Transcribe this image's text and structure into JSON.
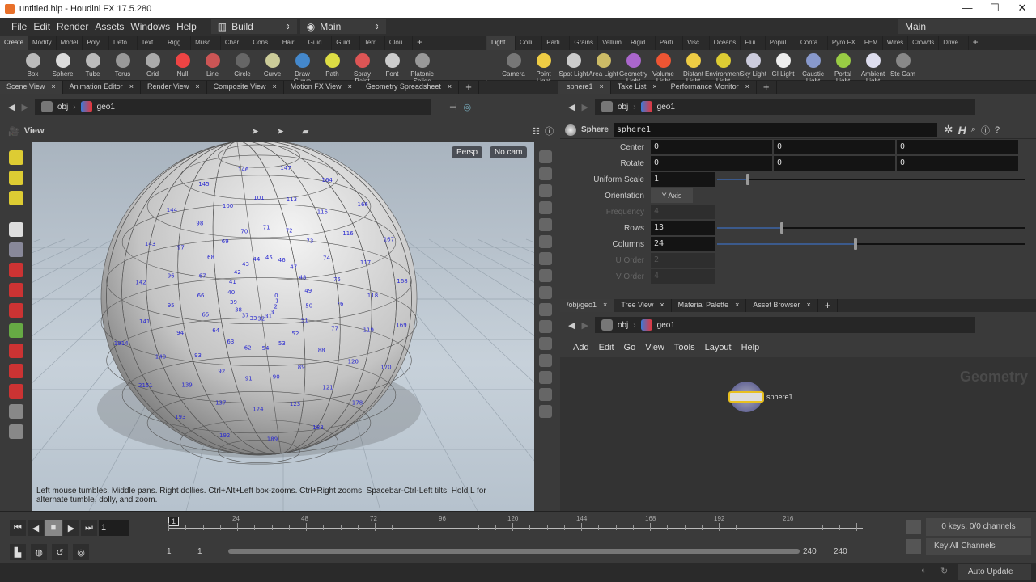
{
  "window": {
    "title": "untitled.hip - Houdini FX 17.5.280",
    "controls": [
      "—",
      "☐",
      "✕"
    ]
  },
  "menu": {
    "items": [
      "File",
      "Edit",
      "Render",
      "Assets",
      "Windows",
      "Help"
    ],
    "desktop": "Build",
    "context": "Main",
    "right_context": "Main"
  },
  "shelf_left": {
    "tabs": [
      "Create",
      "Modify",
      "Model",
      "Poly...",
      "Defo...",
      "Text...",
      "Rigg...",
      "Musc...",
      "Char...",
      "Cons...",
      "Hair...",
      "Guid...",
      "Guid...",
      "Terr...",
      "Clou..."
    ],
    "tools": [
      "Box",
      "Sphere",
      "Tube",
      "Torus",
      "Grid",
      "Null",
      "Line",
      "Circle",
      "Curve",
      "Draw Curve",
      "Path",
      "Spray Paint",
      "Font",
      "Platonic Solids"
    ]
  },
  "shelf_right": {
    "tabs": [
      "Light...",
      "Colli...",
      "Parti...",
      "Grains",
      "Vellum",
      "Rigid...",
      "Parti...",
      "Visc...",
      "Oceans",
      "Flui...",
      "Popul...",
      "Conta...",
      "Pyro FX",
      "FEM",
      "Wires",
      "Crowds",
      "Drive..."
    ],
    "tools": [
      "Camera",
      "Point Light",
      "Spot Light",
      "Area Light",
      "Geometry Light",
      "Volume Light",
      "Distant Light",
      "Environment Light",
      "Sky Light",
      "GI Light",
      "Caustic Light",
      "Portal Light",
      "Ambient Light",
      "Ste Cam"
    ]
  },
  "left_pane": {
    "tabs": [
      "Scene View",
      "Animation Editor",
      "Render View",
      "Composite View",
      "Motion FX View",
      "Geometry Spreadsheet"
    ],
    "path": [
      "obj",
      "geo1"
    ],
    "view_label": "View",
    "persp": "Persp",
    "cam": "No cam",
    "hint": "Left mouse tumbles. Middle pans. Right dollies. Ctrl+Alt+Left box-zooms. Ctrl+Right zooms. Spacebar-Ctrl-Left tilts. Hold L for alternate tumble, dolly, and zoom.",
    "point_numbers": [
      "0",
      "1",
      "2",
      "3",
      "31",
      "32",
      "33",
      "37",
      "38",
      "39",
      "40",
      "41",
      "42",
      "43",
      "44",
      "45",
      "46",
      "47",
      "48",
      "49",
      "50",
      "51",
      "52",
      "53",
      "54",
      "62",
      "63",
      "64",
      "65",
      "66",
      "67",
      "68",
      "69",
      "70",
      "71",
      "72",
      "73",
      "74",
      "75",
      "76",
      "77",
      "88",
      "89",
      "90",
      "91",
      "92",
      "93",
      "94",
      "95",
      "96",
      "97",
      "98",
      "100",
      "101",
      "113",
      "115",
      "116",
      "117",
      "118",
      "119",
      "120",
      "121",
      "123",
      "124",
      "137",
      "139",
      "140",
      "141",
      "142",
      "143",
      "144",
      "145",
      "146",
      "147",
      "164",
      "166",
      "167",
      "168",
      "169",
      "170",
      "178",
      "188",
      "189",
      "192",
      "193",
      "2151",
      "1914"
    ]
  },
  "params": {
    "tabs": [
      "sphere1",
      "Take List",
      "Performance Monitor"
    ],
    "path": [
      "obj",
      "geo1"
    ],
    "node_type": "Sphere",
    "node_name": "sphere1",
    "center": [
      "0",
      "0",
      "0"
    ],
    "rotate": [
      "0",
      "0",
      "0"
    ],
    "uniform_scale": "1",
    "orientation": "Y Axis",
    "frequency": "4",
    "rows": "13",
    "columns": "24",
    "u_order": "2",
    "v_order": "4",
    "labels": {
      "center": "Center",
      "rotate": "Rotate",
      "uniform_scale": "Uniform Scale",
      "orientation": "Orientation",
      "frequency": "Frequency",
      "rows": "Rows",
      "columns": "Columns",
      "u_order": "U Order",
      "v_order": "V Order"
    },
    "slider_fractions": {
      "uniform_scale": 0.1,
      "rows": 0.21,
      "columns": 0.45
    }
  },
  "network": {
    "tabs": [
      "/obj/geo1",
      "Tree View",
      "Material Palette",
      "Asset Browser"
    ],
    "path": [
      "obj",
      "geo1"
    ],
    "menu": [
      "Add",
      "Edit",
      "Go",
      "View",
      "Tools",
      "Layout",
      "Help"
    ],
    "watermark": "Geometry",
    "node_label": "sphere1"
  },
  "timeline": {
    "frame": "1",
    "ticks": [
      "24",
      "48",
      "72",
      "96",
      "120",
      "144",
      "168",
      "192",
      "216"
    ],
    "current": "1",
    "start": "1",
    "start2": "1",
    "end": "240",
    "end2": "240",
    "keys": "0 keys, 0/0 channels",
    "key_mode": "Key All Channels"
  },
  "status": {
    "update": "Auto Update"
  }
}
